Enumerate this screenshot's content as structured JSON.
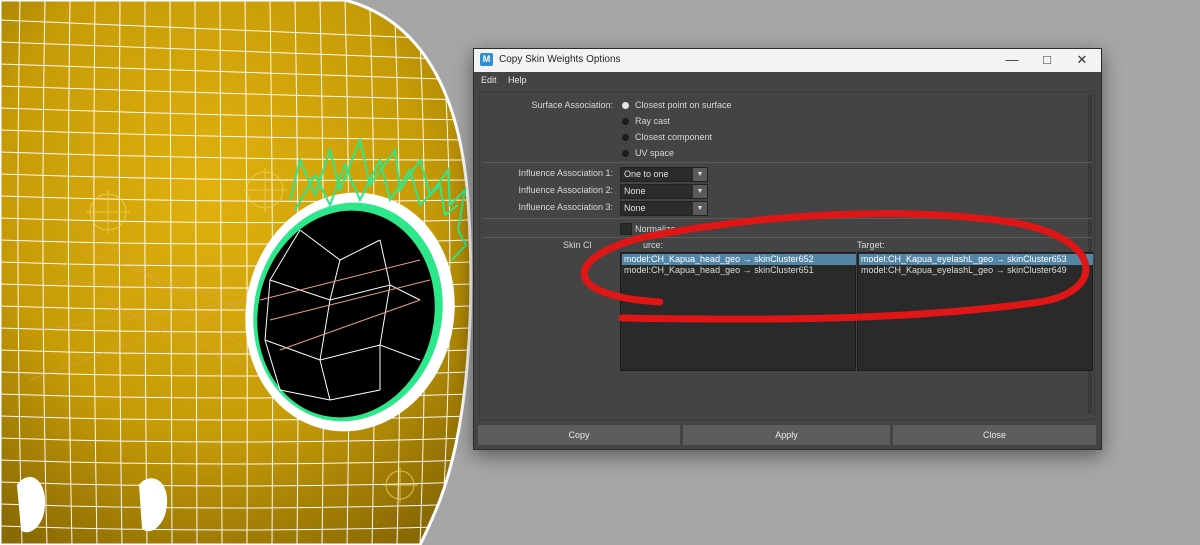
{
  "window": {
    "title": "Copy Skin Weights Options",
    "app_icon": "M"
  },
  "menubar": {
    "items": [
      "Edit",
      "Help"
    ]
  },
  "surface_association": {
    "label": "Surface Association:",
    "options": [
      "Closest point on surface",
      "Ray cast",
      "Closest component",
      "UV space"
    ],
    "selected": "Closest point on surface"
  },
  "influence": [
    {
      "label": "Influence Association 1:",
      "value": "One to one"
    },
    {
      "label": "Influence Association 2:",
      "value": "None"
    },
    {
      "label": "Influence Association 3:",
      "value": "None"
    }
  ],
  "normalize": {
    "label": "Normalize",
    "checked": false
  },
  "skin_clusters": {
    "label": "Skin Cl",
    "source_header": "urce:",
    "target_header": "Target:",
    "source": [
      {
        "text": "model:CH_Kapua_head_geo → skinCluster652",
        "selected": true
      },
      {
        "text": "model:CH_Kapua_head_geo → skinCluster651",
        "selected": false
      }
    ],
    "target": [
      {
        "text": "model:CH_Kapua_eyelashL_geo → skinCluster653",
        "selected": true
      },
      {
        "text": "model:CH_Kapua_eyelashL_geo → skinCluster649",
        "selected": false
      }
    ]
  },
  "buttons": {
    "copy": "Copy",
    "apply": "Apply",
    "close": "Close"
  },
  "colors": {
    "selection": "#5285a6",
    "annotation": "#e01515",
    "wireframe": "#ffffff",
    "highlight_wire": "#2de88a",
    "surface": "#c9a10a"
  }
}
